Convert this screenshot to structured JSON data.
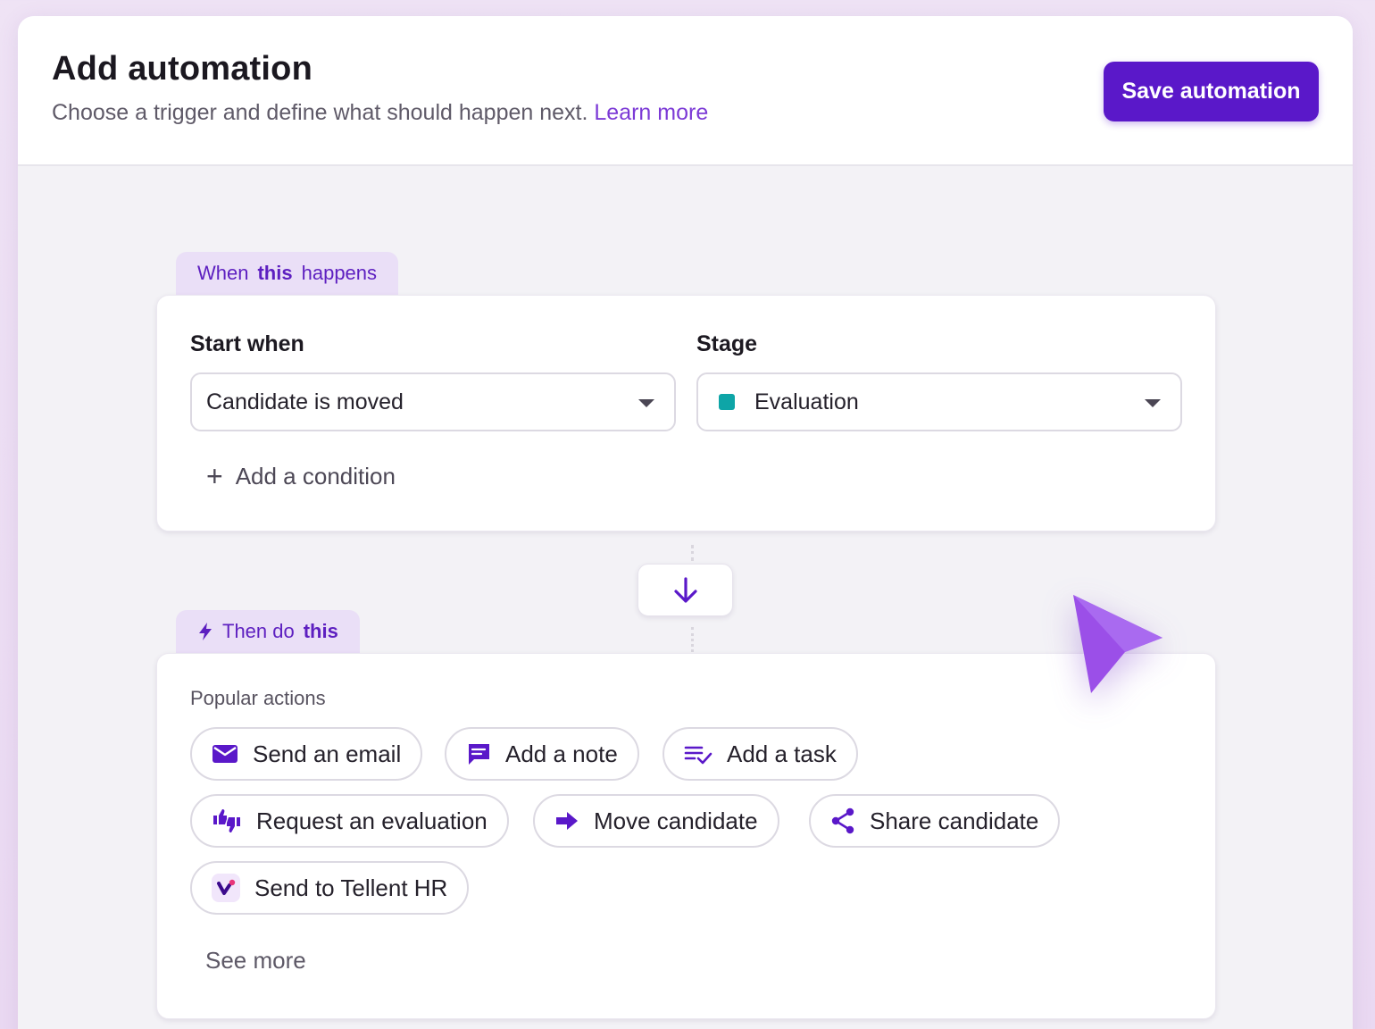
{
  "header": {
    "title": "Add automation",
    "subtitle": "Choose a trigger and define what should happen next.",
    "learn_more": "Learn more",
    "save_label": "Save automation"
  },
  "trigger": {
    "tab_prefix": "When",
    "tab_bold": "this",
    "tab_suffix": "happens",
    "start_when_label": "Start when",
    "start_when_value": "Candidate is moved",
    "stage_label": "Stage",
    "stage_value": "Evaluation",
    "stage_color": "#0ea5a7",
    "add_condition": "Add a condition"
  },
  "action": {
    "tab_prefix": "Then do",
    "tab_bold": "this",
    "popular_label": "Popular actions",
    "chips": [
      {
        "label": "Send an email",
        "icon": "mail-icon"
      },
      {
        "label": "Add a note",
        "icon": "note-icon"
      },
      {
        "label": "Add a task",
        "icon": "task-icon"
      },
      {
        "label": "Request an evaluation",
        "icon": "thumbs-icon"
      },
      {
        "label": "Move candidate",
        "icon": "arrow-right-icon"
      },
      {
        "label": "Share candidate",
        "icon": "share-icon"
      },
      {
        "label": "Send to Tellent HR",
        "icon": "tellent-logo-icon"
      }
    ],
    "see_more": "See more"
  },
  "colors": {
    "accent": "#5a18c9",
    "link": "#7c3ad6",
    "cursor": "#9b4fe8"
  }
}
